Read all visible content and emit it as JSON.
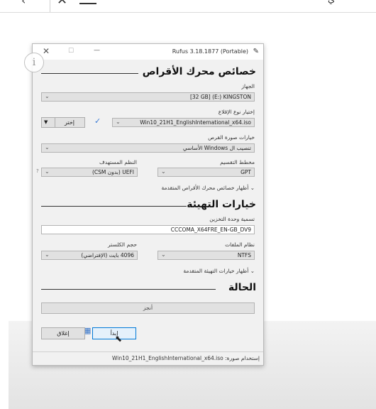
{
  "topbar": {
    "back_glyph": "‹",
    "close_glyph": "✕",
    "right_glyph": "ي"
  },
  "window": {
    "title": "Rufus 3.18.1877 (Portable)",
    "controls": {
      "close": "✕",
      "maximize": "☐",
      "minimize": "—"
    },
    "pen_icon": "✎",
    "info_glyph": "i"
  },
  "drive_section": {
    "title": "خصائص محرك الأقراص",
    "device_label": "الجهاز",
    "device_value": "[32 GB] (E:) KINGSTON",
    "boot_label": "إختيار نوع الإقلاع",
    "boot_value": "Win10_21H1_EnglishInternational_x64.iso",
    "select_button": "إختر",
    "image_option_label": "خيارات صورة القرص",
    "image_option_value": "تنصيب ال Windows الأساسي",
    "partition_label": "مخطط التقسيم",
    "partition_value": "GPT",
    "target_label": "النظم المستهدف",
    "target_value": "UEFI (بدون CSM)",
    "help_mark": "?",
    "advanced_toggle": "أظهار خصائص محرك الأقراص المتقدمة"
  },
  "format_section": {
    "title": "خيارات التهيئة",
    "volume_label": "تسمية وحدة التخزين",
    "volume_value": "CCCOMA_X64FRE_EN-GB_DV9",
    "filesystem_label": "نظام الملفات",
    "filesystem_value": "NTFS",
    "cluster_label": "حجم الكلستر",
    "cluster_value": "4096 بايت (الإفتراضي)",
    "advanced_toggle": "أظهار خيارات التهيئة المتقدمة"
  },
  "status_section": {
    "title": "الحالة",
    "progress_text": "أنجز",
    "progress": 1.0
  },
  "actions": {
    "start_button": "إبدأ",
    "close_button": "إغلاق"
  },
  "statusbar": {
    "text": "إستخدام صورة: Win10_21H1_EnglishInternational_x64.iso"
  }
}
